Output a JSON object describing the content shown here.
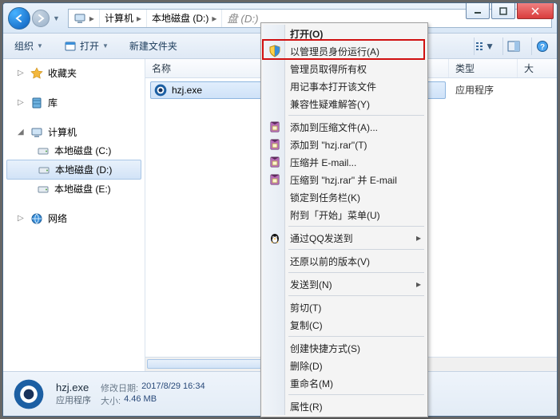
{
  "window_controls": {
    "min": "_",
    "max": "▢",
    "close": "✕"
  },
  "breadcrumb": {
    "item1": "计算机",
    "item2": "本地磁盘 (D:)",
    "hint": "盘 (D:)"
  },
  "toolbar": {
    "organize": "组织",
    "open": "打开",
    "newfolder": "新建文件夹"
  },
  "columns": {
    "name": "名称",
    "type": "类型",
    "size_abbrev": "大"
  },
  "sidebar": {
    "favorites": "收藏夹",
    "libraries": "库",
    "computer": "计算机",
    "drives": [
      {
        "label": "本地磁盘 (C:)"
      },
      {
        "label": "本地磁盘 (D:)"
      },
      {
        "label": "本地磁盘 (E:)"
      }
    ],
    "network": "网络"
  },
  "filelist": {
    "rows": [
      {
        "name": "hzj.exe",
        "type": "应用程序"
      }
    ]
  },
  "details": {
    "name": "hzj.exe",
    "type": "应用程序",
    "kv": [
      {
        "k": "修改日期:",
        "v": "2017/8/29 16:34"
      },
      {
        "k": "大小:",
        "v": "4.46 MB"
      }
    ]
  },
  "context_menu": [
    {
      "t": "open",
      "label": "打开(O)",
      "bold": true
    },
    {
      "t": "runas",
      "label": "以管理员身份运行(A)",
      "icon": "shield"
    },
    {
      "t": "takeown",
      "label": "管理员取得所有权"
    },
    {
      "t": "notepad",
      "label": "用记事本打开该文件"
    },
    {
      "t": "compat",
      "label": "兼容性疑难解答(Y)"
    },
    {
      "t": "sep"
    },
    {
      "t": "addrar",
      "label": "添加到压缩文件(A)...",
      "icon": "rar"
    },
    {
      "t": "addrar2",
      "label": "添加到 \"hzj.rar\"(T)",
      "icon": "rar"
    },
    {
      "t": "ziemail",
      "label": "压缩并 E-mail...",
      "icon": "rar"
    },
    {
      "t": "ziemail2",
      "label": "压缩到 \"hzj.rar\" 并 E-mail",
      "icon": "rar"
    },
    {
      "t": "pin",
      "label": "锁定到任务栏(K)"
    },
    {
      "t": "pinstart",
      "label": "附到「开始」菜单(U)"
    },
    {
      "t": "sep"
    },
    {
      "t": "qqsend",
      "label": "通过QQ发送到",
      "icon": "qq",
      "sub": true
    },
    {
      "t": "sep"
    },
    {
      "t": "restore",
      "label": "还原以前的版本(V)"
    },
    {
      "t": "sep"
    },
    {
      "t": "sendto",
      "label": "发送到(N)",
      "sub": true
    },
    {
      "t": "sep"
    },
    {
      "t": "cut",
      "label": "剪切(T)"
    },
    {
      "t": "copy",
      "label": "复制(C)"
    },
    {
      "t": "sep"
    },
    {
      "t": "shortcut",
      "label": "创建快捷方式(S)"
    },
    {
      "t": "delete",
      "label": "删除(D)"
    },
    {
      "t": "rename",
      "label": "重命名(M)"
    },
    {
      "t": "sep"
    },
    {
      "t": "props",
      "label": "属性(R)"
    }
  ]
}
